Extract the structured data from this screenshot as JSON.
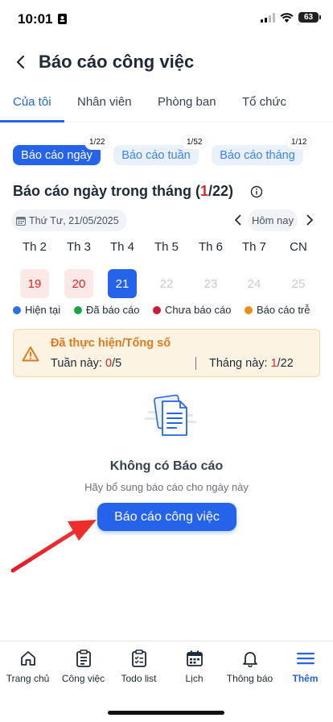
{
  "status": {
    "time": "10:01",
    "battery": "63"
  },
  "header": {
    "title": "Báo cáo công việc"
  },
  "tabs": [
    "Của tôi",
    "Nhân viên",
    "Phòng ban",
    "Tổ chức"
  ],
  "chips": [
    {
      "label": "Báo cáo ngày",
      "count": "1/22"
    },
    {
      "label": "Báo cáo tuần",
      "count": "1/52"
    },
    {
      "label": "Báo cáo tháng",
      "count": "1/12"
    }
  ],
  "section": {
    "title_prefix": "Báo cáo ngày trong tháng (",
    "done": "1",
    "title_suffix": "/22)"
  },
  "date_nav": {
    "date": "Thứ Tư, 21/05/2025",
    "today": "Hôm nay"
  },
  "calendar": {
    "weekdays": [
      "Th 2",
      "Th 3",
      "Th 4",
      "Th 5",
      "Th 6",
      "Th 7",
      "CN"
    ],
    "days": [
      "19",
      "20",
      "21",
      "22",
      "23",
      "24",
      "25"
    ]
  },
  "legend": [
    {
      "label": "Hiện tại",
      "color": "#2f6fe0"
    },
    {
      "label": "Đã báo cáo",
      "color": "#1aa34a"
    },
    {
      "label": "Chưa báo cáo",
      "color": "#c81e3a"
    },
    {
      "label": "Báo cáo trễ",
      "color": "#f08c1a"
    }
  ],
  "summary": {
    "title": "Đã thực hiện/Tổng số",
    "week_label": "Tuần này: ",
    "week_done": "0",
    "week_total": "/5",
    "month_label": "Tháng này: ",
    "month_done": "1",
    "month_total": "/22"
  },
  "empty": {
    "title": "Không có Báo cáo",
    "subtitle": "Hãy bổ sung báo cáo cho ngày này",
    "button": "Báo cáo công việc"
  },
  "bottom_nav": [
    "Trang chủ",
    "Công việc",
    "Todo list",
    "Lịch",
    "Thông báo",
    "Thêm"
  ]
}
